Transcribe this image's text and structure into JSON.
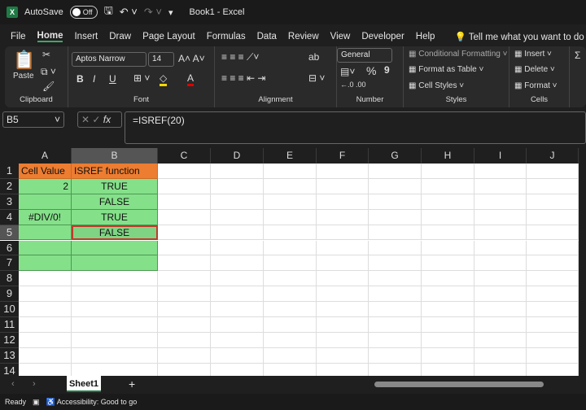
{
  "titlebar": {
    "autosave": "AutoSave",
    "toggle": "Off",
    "title": "Book1  -  Excel"
  },
  "menu": [
    "File",
    "Home",
    "Insert",
    "Draw",
    "Page Layout",
    "Formulas",
    "Data",
    "Review",
    "View",
    "Developer",
    "Help"
  ],
  "tell_me": "Tell me what you want to do",
  "ribbon": {
    "clipboard": {
      "paste": "Paste",
      "label": "Clipboard"
    },
    "font": {
      "name": "Aptos Narrow",
      "size": "14",
      "bold": "B",
      "italic": "I",
      "underline": "U",
      "label": "Font"
    },
    "alignment": {
      "label": "Alignment"
    },
    "number": {
      "format": "General",
      "percent": "%",
      "comma": "9",
      "label": "Number"
    },
    "styles": {
      "conditional": "Conditional Formatting",
      "table": "Format as Table",
      "cell": "Cell Styles",
      "label": "Styles"
    },
    "cells": {
      "insert": "Insert",
      "delete": "Delete",
      "format": "Format",
      "label": "Cells"
    }
  },
  "formula_bar": {
    "name_box": "B5",
    "fx": "fx",
    "formula": "=ISREF(20)"
  },
  "colors": {
    "header_fill": "#ed7d31",
    "data_fill": "#85e08a",
    "selection": "#c0392b"
  },
  "grid": {
    "columns": [
      "A",
      "B",
      "C",
      "D",
      "E",
      "F",
      "G",
      "H",
      "I",
      "J"
    ],
    "rows": [
      "1",
      "2",
      "3",
      "4",
      "5",
      "6",
      "7",
      "8",
      "9",
      "10",
      "11",
      "12",
      "13",
      "14"
    ],
    "selected": "B5",
    "cells": [
      [
        "Cell Value",
        "ISREF function"
      ],
      [
        "2",
        "TRUE"
      ],
      [
        "",
        "FALSE"
      ],
      [
        "#DIV/0!",
        "TRUE"
      ],
      [
        "",
        "FALSE"
      ],
      [
        "",
        ""
      ],
      [
        "",
        ""
      ]
    ]
  },
  "sheets": {
    "tabs": [
      "Sheet1"
    ],
    "add": "+"
  },
  "status": {
    "ready": "Ready",
    "accessibility": "Accessibility: Good to go"
  }
}
